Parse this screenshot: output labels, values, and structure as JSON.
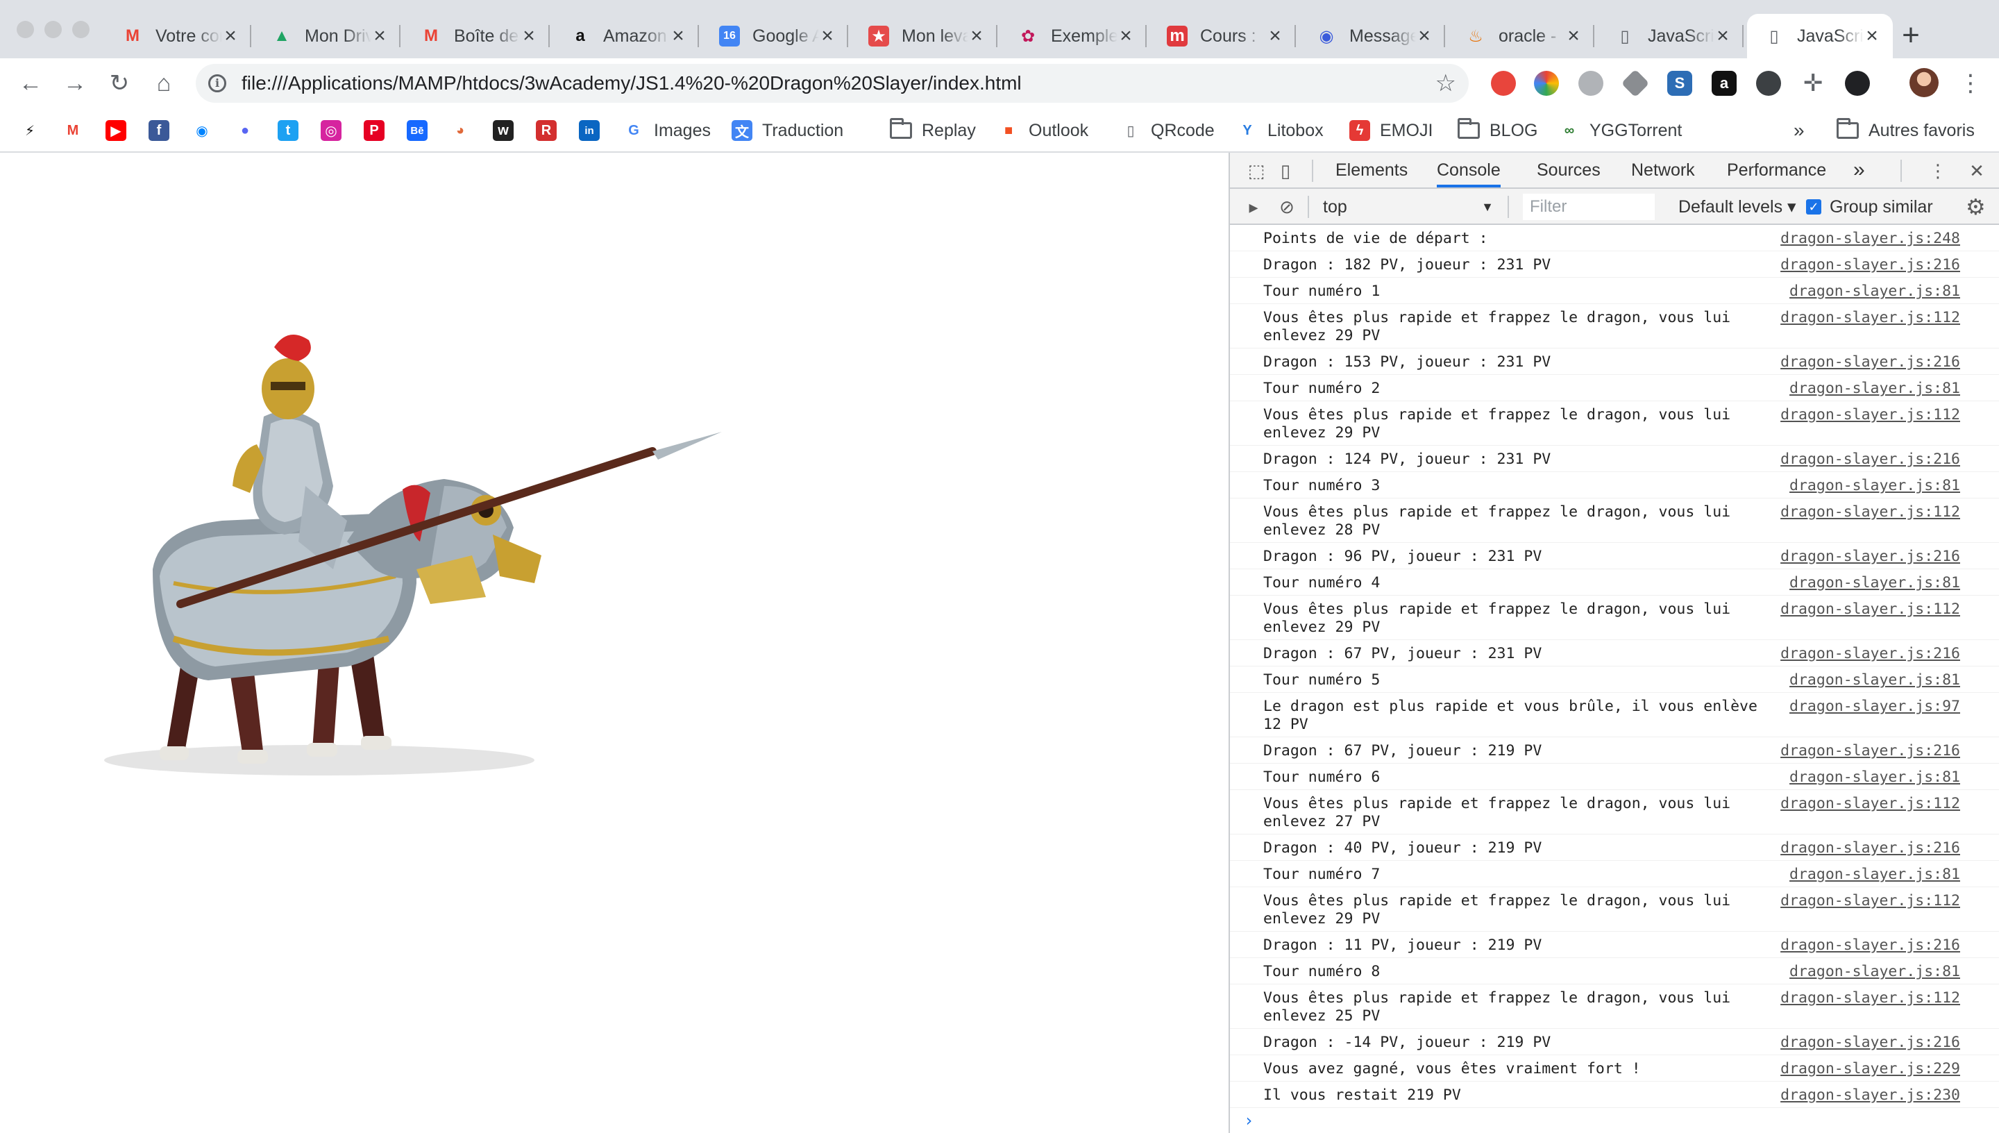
{
  "tabs": [
    {
      "icon": "gmail-icon",
      "title": "Votre compte",
      "active": false
    },
    {
      "icon": "google-drive-icon",
      "title": "Mon Drive",
      "active": false
    },
    {
      "icon": "gmail-icon",
      "title": "Boîte de réception",
      "active": false
    },
    {
      "icon": "amazon-icon",
      "title": "Amazon",
      "active": false
    },
    {
      "icon": "google-calendar-icon",
      "title": "Google Agenda",
      "active": false
    },
    {
      "icon": "star-badge-icon",
      "title": "Mon levain",
      "active": false
    },
    {
      "icon": "flower-icon",
      "title": "Exemple",
      "active": false
    },
    {
      "icon": "m-logo-icon",
      "title": "Cours :",
      "active": false
    },
    {
      "icon": "messenger-icon",
      "title": "Messages",
      "active": false
    },
    {
      "icon": "java-icon",
      "title": "oracle - ",
      "active": false
    },
    {
      "icon": "document-icon",
      "title": "JavaScript",
      "active": false
    },
    {
      "icon": "document-icon",
      "title": "JavaScript",
      "active": true
    }
  ],
  "tab_close_glyph": "×",
  "new_tab_glyph": "+",
  "toolbar": {
    "back_glyph": "←",
    "forward_glyph": "→",
    "reload_glyph": "↻",
    "home_glyph": "⌂",
    "info_glyph": "i",
    "url": "file:///Applications/MAMP/htdocs/3wAcademy/JS1.4%20-%20Dragon%20Slayer/index.html",
    "star_glyph": "☆",
    "menu_glyph": "⋮"
  },
  "bookmarks": [
    {
      "icon": "bolt-icon",
      "label": ""
    },
    {
      "icon": "gmail-icon",
      "label": ""
    },
    {
      "icon": "youtube-icon",
      "label": ""
    },
    {
      "icon": "facebook-icon",
      "label": ""
    },
    {
      "icon": "messenger-icon",
      "label": ""
    },
    {
      "icon": "discord-icon",
      "label": ""
    },
    {
      "icon": "twitter-icon",
      "label": ""
    },
    {
      "icon": "instagram-icon",
      "label": ""
    },
    {
      "icon": "pinterest-icon",
      "label": ""
    },
    {
      "icon": "behance-icon",
      "label": ""
    },
    {
      "icon": "globe-icon",
      "label": ""
    },
    {
      "icon": "mastodon-icon",
      "label": ""
    },
    {
      "icon": "rtl-icon",
      "label": ""
    },
    {
      "icon": "linkedin-icon",
      "label": ""
    },
    {
      "icon": "google-icon",
      "label": "Images"
    },
    {
      "icon": "translate-icon",
      "label": "Traduction"
    },
    {
      "icon": "folder-icon",
      "label": "Replay"
    },
    {
      "icon": "microsoft-icon",
      "label": "Outlook"
    },
    {
      "icon": "document-icon",
      "label": "QRcode"
    },
    {
      "icon": "litobox-icon",
      "label": "Litobox"
    },
    {
      "icon": "emoji-icon",
      "label": "EMOJI"
    },
    {
      "icon": "folder-icon",
      "label": "BLOG"
    },
    {
      "icon": "ygg-icon",
      "label": "YGGTorrent"
    }
  ],
  "bookmarks_more": "»",
  "other_bookmarks": "Autres favoris",
  "devtools": {
    "tabs": [
      "Elements",
      "Console",
      "Sources",
      "Network",
      "Performance"
    ],
    "active_tab": "Console",
    "more_glyph": "»",
    "kebab_glyph": "⋮",
    "close_glyph": "✕",
    "context": "top",
    "context_caret": "▼",
    "filter_placeholder": "Filter",
    "levels": "Default levels ▾",
    "group_similar": "Group similar",
    "group_similar_checked": true,
    "prompt_glyph": "›"
  },
  "console_logs": [
    {
      "msg": "Points de vie de départ :",
      "src": "dragon-slayer.js:248"
    },
    {
      "msg": "Dragon : 182 PV, joueur : 231 PV",
      "src": "dragon-slayer.js:216"
    },
    {
      "msg": "Tour numéro 1",
      "src": "dragon-slayer.js:81"
    },
    {
      "msg": "Vous êtes plus rapide et frappez le dragon, vous lui\nenlevez 29 PV",
      "src": "dragon-slayer.js:112"
    },
    {
      "msg": "Dragon : 153 PV, joueur : 231 PV",
      "src": "dragon-slayer.js:216"
    },
    {
      "msg": "Tour numéro 2",
      "src": "dragon-slayer.js:81"
    },
    {
      "msg": "Vous êtes plus rapide et frappez le dragon, vous lui\nenlevez 29 PV",
      "src": "dragon-slayer.js:112"
    },
    {
      "msg": "Dragon : 124 PV, joueur : 231 PV",
      "src": "dragon-slayer.js:216"
    },
    {
      "msg": "Tour numéro 3",
      "src": "dragon-slayer.js:81"
    },
    {
      "msg": "Vous êtes plus rapide et frappez le dragon, vous lui\nenlevez 28 PV",
      "src": "dragon-slayer.js:112"
    },
    {
      "msg": "Dragon : 96 PV, joueur : 231 PV",
      "src": "dragon-slayer.js:216"
    },
    {
      "msg": "Tour numéro 4",
      "src": "dragon-slayer.js:81"
    },
    {
      "msg": "Vous êtes plus rapide et frappez le dragon, vous lui\nenlevez 29 PV",
      "src": "dragon-slayer.js:112"
    },
    {
      "msg": "Dragon : 67 PV, joueur : 231 PV",
      "src": "dragon-slayer.js:216"
    },
    {
      "msg": "Tour numéro 5",
      "src": "dragon-slayer.js:81"
    },
    {
      "msg": "Le dragon est plus rapide et vous brûle, il vous enlève\n12 PV",
      "src": "dragon-slayer.js:97"
    },
    {
      "msg": "Dragon : 67 PV, joueur : 219 PV",
      "src": "dragon-slayer.js:216"
    },
    {
      "msg": "Tour numéro 6",
      "src": "dragon-slayer.js:81"
    },
    {
      "msg": "Vous êtes plus rapide et frappez le dragon, vous lui\nenlevez 27 PV",
      "src": "dragon-slayer.js:112"
    },
    {
      "msg": "Dragon : 40 PV, joueur : 219 PV",
      "src": "dragon-slayer.js:216"
    },
    {
      "msg": "Tour numéro 7",
      "src": "dragon-slayer.js:81"
    },
    {
      "msg": "Vous êtes plus rapide et frappez le dragon, vous lui\nenlevez 29 PV",
      "src": "dragon-slayer.js:112"
    },
    {
      "msg": "Dragon : 11 PV, joueur : 219 PV",
      "src": "dragon-slayer.js:216"
    },
    {
      "msg": "Tour numéro 8",
      "src": "dragon-slayer.js:81"
    },
    {
      "msg": "Vous êtes plus rapide et frappez le dragon, vous lui\nenlevez 25 PV",
      "src": "dragon-slayer.js:112"
    },
    {
      "msg": "Dragon : -14 PV, joueur : 219 PV",
      "src": "dragon-slayer.js:216"
    },
    {
      "msg": "Vous avez gagné, vous êtes vraiment fort !",
      "src": "dragon-slayer.js:229"
    },
    {
      "msg": "Il vous restait 219 PV",
      "src": "dragon-slayer.js:230"
    }
  ],
  "page": {
    "image_subject": "knight-on-armored-horse"
  }
}
